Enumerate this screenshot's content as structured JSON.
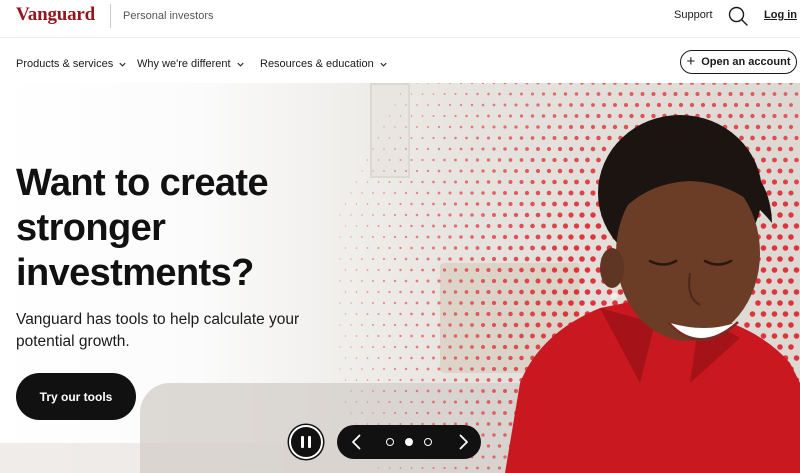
{
  "header": {
    "logo_text": "Vanguard",
    "site_label": "Personal investors",
    "support_label": "Support",
    "search_icon": "search-icon",
    "login_label": "Log in"
  },
  "nav": {
    "items": [
      {
        "label": "Products & services"
      },
      {
        "label": "Why we're different"
      },
      {
        "label": "Resources & education"
      }
    ],
    "open_account_label": "Open an account"
  },
  "hero": {
    "title": "Want to create stronger investments?",
    "subtitle": "Vanguard has tools to help calculate your potential growth.",
    "cta_label": "Try our tools",
    "carousel": {
      "slide_count": 3,
      "active_slide": 2,
      "pause_icon": "pause-icon",
      "prev_icon": "chevron-left-icon",
      "next_icon": "chevron-right-icon"
    }
  },
  "colors": {
    "brand": "#96151d",
    "dot_accent": "#e0202b",
    "shirt": "#c9181f",
    "dark": "#111111"
  }
}
